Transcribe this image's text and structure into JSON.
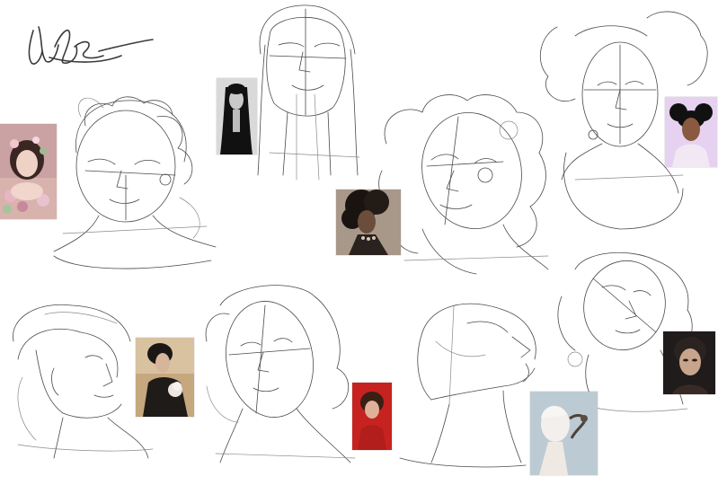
{
  "canvas": {
    "background": "#ffffff",
    "stroke_color": "#4a4a4a"
  },
  "signature": {
    "text": "UL&"
  },
  "references": [
    {
      "name": "ref-flower-girl",
      "palette": [
        "#d9a6ad",
        "#c48890",
        "#f2d9d6",
        "#a5c3a0"
      ]
    },
    {
      "name": "ref-monochrome-woman",
      "palette": [
        "#111111",
        "#d6d6d6",
        "#8a8a8a"
      ]
    },
    {
      "name": "ref-curly-hair-woman",
      "palette": [
        "#1c1714",
        "#a9937f",
        "#6c5a4c"
      ]
    },
    {
      "name": "ref-afro-puffs-woman",
      "palette": [
        "#111111",
        "#e9d4f2",
        "#8a5f45"
      ]
    },
    {
      "name": "ref-man-dark-coat",
      "palette": [
        "#c6a77e",
        "#1f1b19",
        "#e8e1d8"
      ]
    },
    {
      "name": "ref-red-portrait",
      "palette": [
        "#c62320",
        "#3b2116",
        "#e2b39a"
      ]
    },
    {
      "name": "ref-albino-lizard",
      "palette": [
        "#b9c7cf",
        "#f2efec",
        "#5a4d45"
      ]
    },
    {
      "name": "ref-dark-makeup-woman",
      "palette": [
        "#201d1c",
        "#c9a48d",
        "#5a3c30"
      ]
    }
  ]
}
